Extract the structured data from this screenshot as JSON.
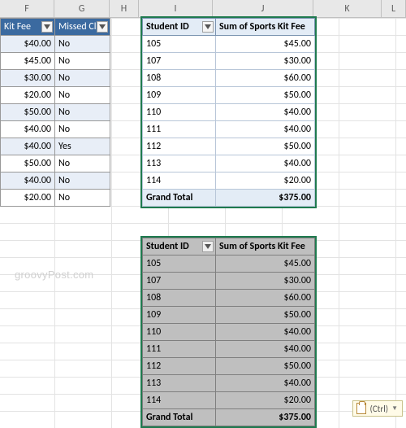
{
  "columns": [
    "F",
    "G",
    "H",
    "I",
    "J",
    "K",
    "L"
  ],
  "source_table": {
    "headers": {
      "fee": "Kit Fee",
      "missed": "Missed Cl"
    },
    "rows": [
      {
        "fee": "$40.00",
        "missed": "No",
        "band": true
      },
      {
        "fee": "$45.00",
        "missed": "No",
        "band": false
      },
      {
        "fee": "$30.00",
        "missed": "No",
        "band": true
      },
      {
        "fee": "$20.00",
        "missed": "No",
        "band": false
      },
      {
        "fee": "$50.00",
        "missed": "No",
        "band": true
      },
      {
        "fee": "$40.00",
        "missed": "No",
        "band": false
      },
      {
        "fee": "$40.00",
        "missed": "Yes",
        "band": true
      },
      {
        "fee": "$50.00",
        "missed": "No",
        "band": false
      },
      {
        "fee": "$40.00",
        "missed": "No",
        "band": true
      },
      {
        "fee": "$20.00",
        "missed": "No",
        "band": false
      }
    ]
  },
  "pivot": {
    "headers": {
      "id": "Student ID",
      "sum": "Sum of Sports Kit Fee"
    },
    "rows": [
      {
        "id": "105",
        "sum": "$45.00"
      },
      {
        "id": "107",
        "sum": "$30.00"
      },
      {
        "id": "108",
        "sum": "$60.00"
      },
      {
        "id": "109",
        "sum": "$50.00"
      },
      {
        "id": "110",
        "sum": "$40.00"
      },
      {
        "id": "111",
        "sum": "$40.00"
      },
      {
        "id": "112",
        "sum": "$50.00"
      },
      {
        "id": "113",
        "sum": "$40.00"
      },
      {
        "id": "114",
        "sum": "$20.00"
      }
    ],
    "total": {
      "label": "Grand Total",
      "sum": "$375.00"
    }
  },
  "watermark": "groovyPost.com",
  "paste_options": {
    "label": "(Ctrl)"
  }
}
